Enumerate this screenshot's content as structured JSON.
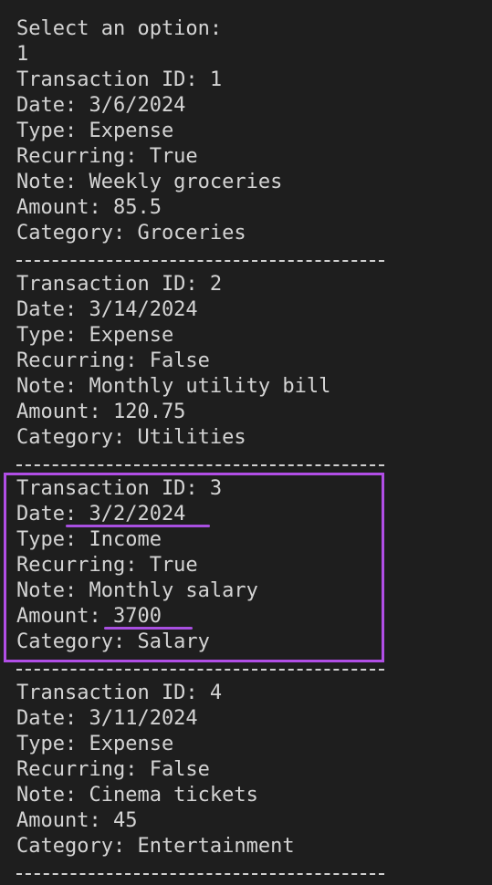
{
  "prompt": "Select an option:",
  "input": "1",
  "separator": "------------------------------",
  "transactions": [
    {
      "id_line": "Transaction ID: 1",
      "date_line": "Date: 3/6/2024",
      "type_line": "Type: Expense",
      "recurring_line": "Recurring: True",
      "note_line": "Note: Weekly groceries",
      "amount_line": "Amount: 85.5",
      "category_line": "Category: Groceries"
    },
    {
      "id_line": "Transaction ID: 2",
      "date_line": "Date: 3/14/2024",
      "type_line": "Type: Expense",
      "recurring_line": "Recurring: False",
      "note_line": "Note: Monthly utility bill",
      "amount_line": "Amount: 120.75",
      "category_line": "Category: Utilities"
    },
    {
      "id_line": "Transaction ID: 3",
      "date_line": "Date: 3/2/2024",
      "type_line": "Type: Income",
      "recurring_line": "Recurring: True",
      "note_line": "Note: Monthly salary",
      "amount_line": "Amount: 3700",
      "category_line": "Category: Salary"
    },
    {
      "id_line": "Transaction ID: 4",
      "date_line": "Date: 3/11/2024",
      "type_line": "Type: Expense",
      "recurring_line": "Recurring: False",
      "note_line": "Note: Cinema tickets",
      "amount_line": "Amount: 45",
      "category_line": "Category: Entertainment"
    }
  ],
  "colors": {
    "background": "#1e1e1e",
    "text": "#d4d4d4",
    "annotation": "#b14ee6"
  }
}
